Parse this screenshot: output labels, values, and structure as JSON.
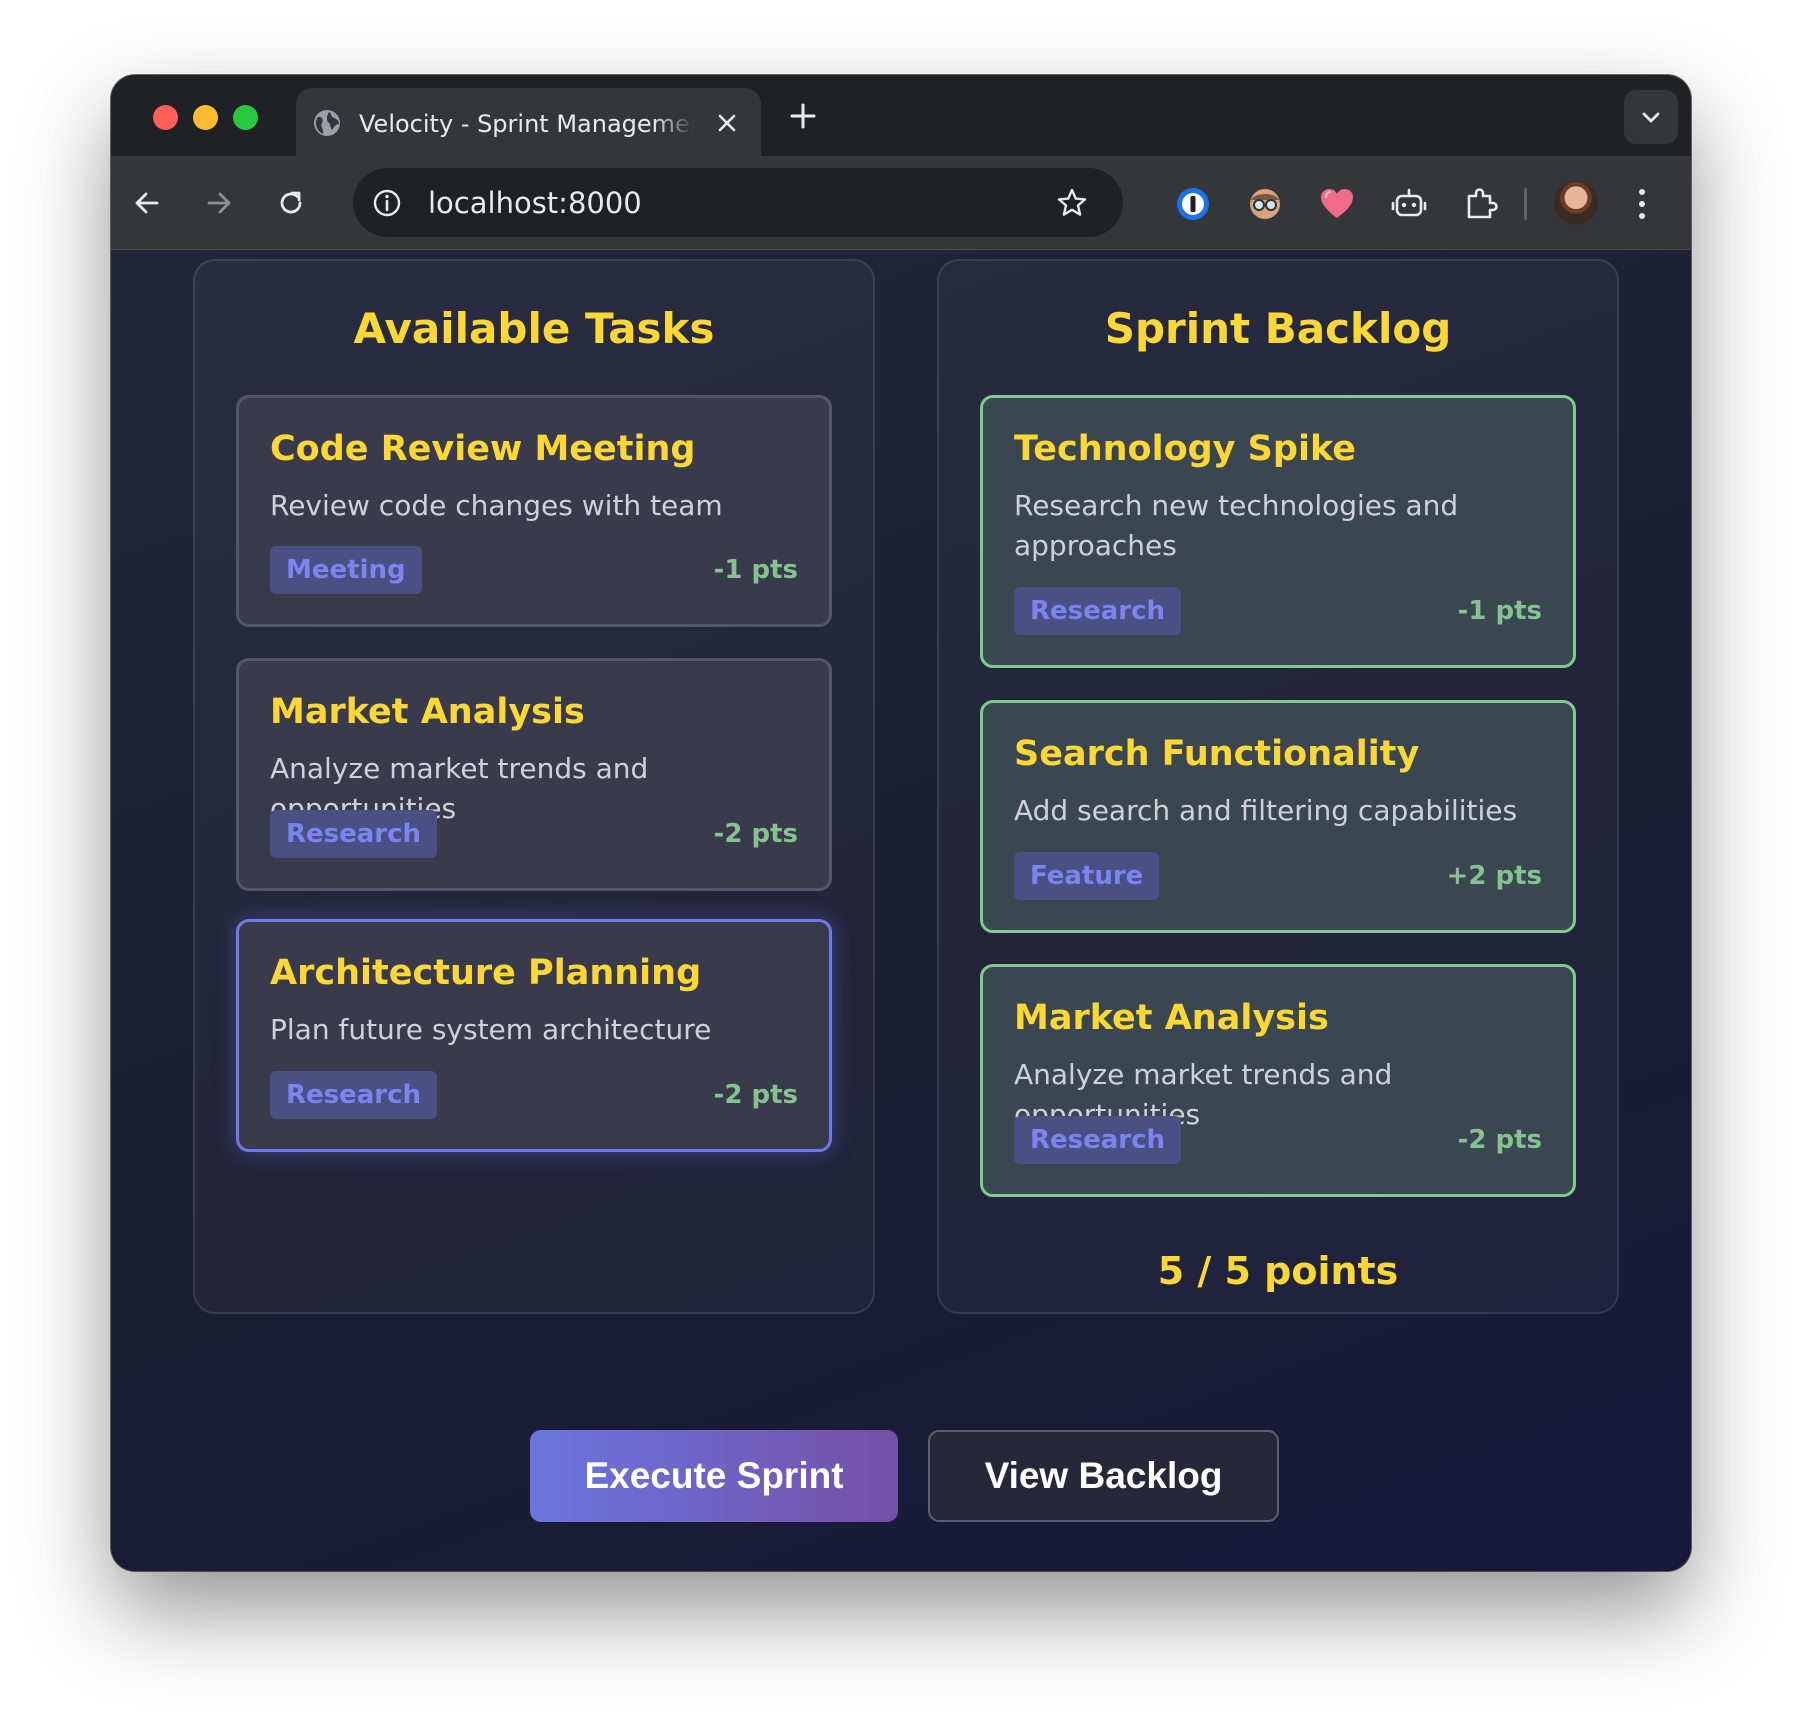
{
  "browser": {
    "tab_title": "Velocity - Sprint Management",
    "url": "localhost:8000"
  },
  "available": {
    "title": "Available Tasks",
    "tasks": [
      {
        "title": "Code Review Meeting",
        "description": "Review code changes with team",
        "tag": "Meeting",
        "points": "-1 pts"
      },
      {
        "title": "Market Analysis",
        "description": "Analyze market trends and opportunities",
        "tag": "Research",
        "points": "-2 pts"
      },
      {
        "title": "Architecture Planning",
        "description": "Plan future system architecture",
        "tag": "Research",
        "points": "-2 pts",
        "selected": true
      }
    ]
  },
  "backlog": {
    "title": "Sprint Backlog",
    "tasks": [
      {
        "title": "Technology Spike",
        "description": "Research new technologies and approaches",
        "tag": "Research",
        "points": "-1 pts"
      },
      {
        "title": "Search Functionality",
        "description": "Add search and filtering capabilities",
        "tag": "Feature",
        "points": "+2 pts"
      },
      {
        "title": "Market Analysis",
        "description": "Analyze market trends and opportunities",
        "tag": "Research",
        "points": "-2 pts"
      }
    ],
    "points_summary": "5 / 5 points"
  },
  "actions": {
    "execute_label": "Execute Sprint",
    "view_backlog_label": "View Backlog"
  },
  "icons": {
    "tab": "globe-icon",
    "toolbar": [
      "back-icon",
      "forward-icon",
      "reload-icon",
      "site-info-icon",
      "bookmark-star-icon"
    ],
    "extensions": [
      "password-manager-icon",
      "glasses-extension-icon",
      "heart-extension-icon",
      "robot-extension-icon",
      "puzzle-extensions-icon"
    ]
  },
  "colors": {
    "accent_yellow": "#fdd835",
    "points_green": "#84c38f",
    "tag_blue": "#7b85ef",
    "selected_border": "#6f78ec",
    "backlog_border": "#82c98d"
  }
}
